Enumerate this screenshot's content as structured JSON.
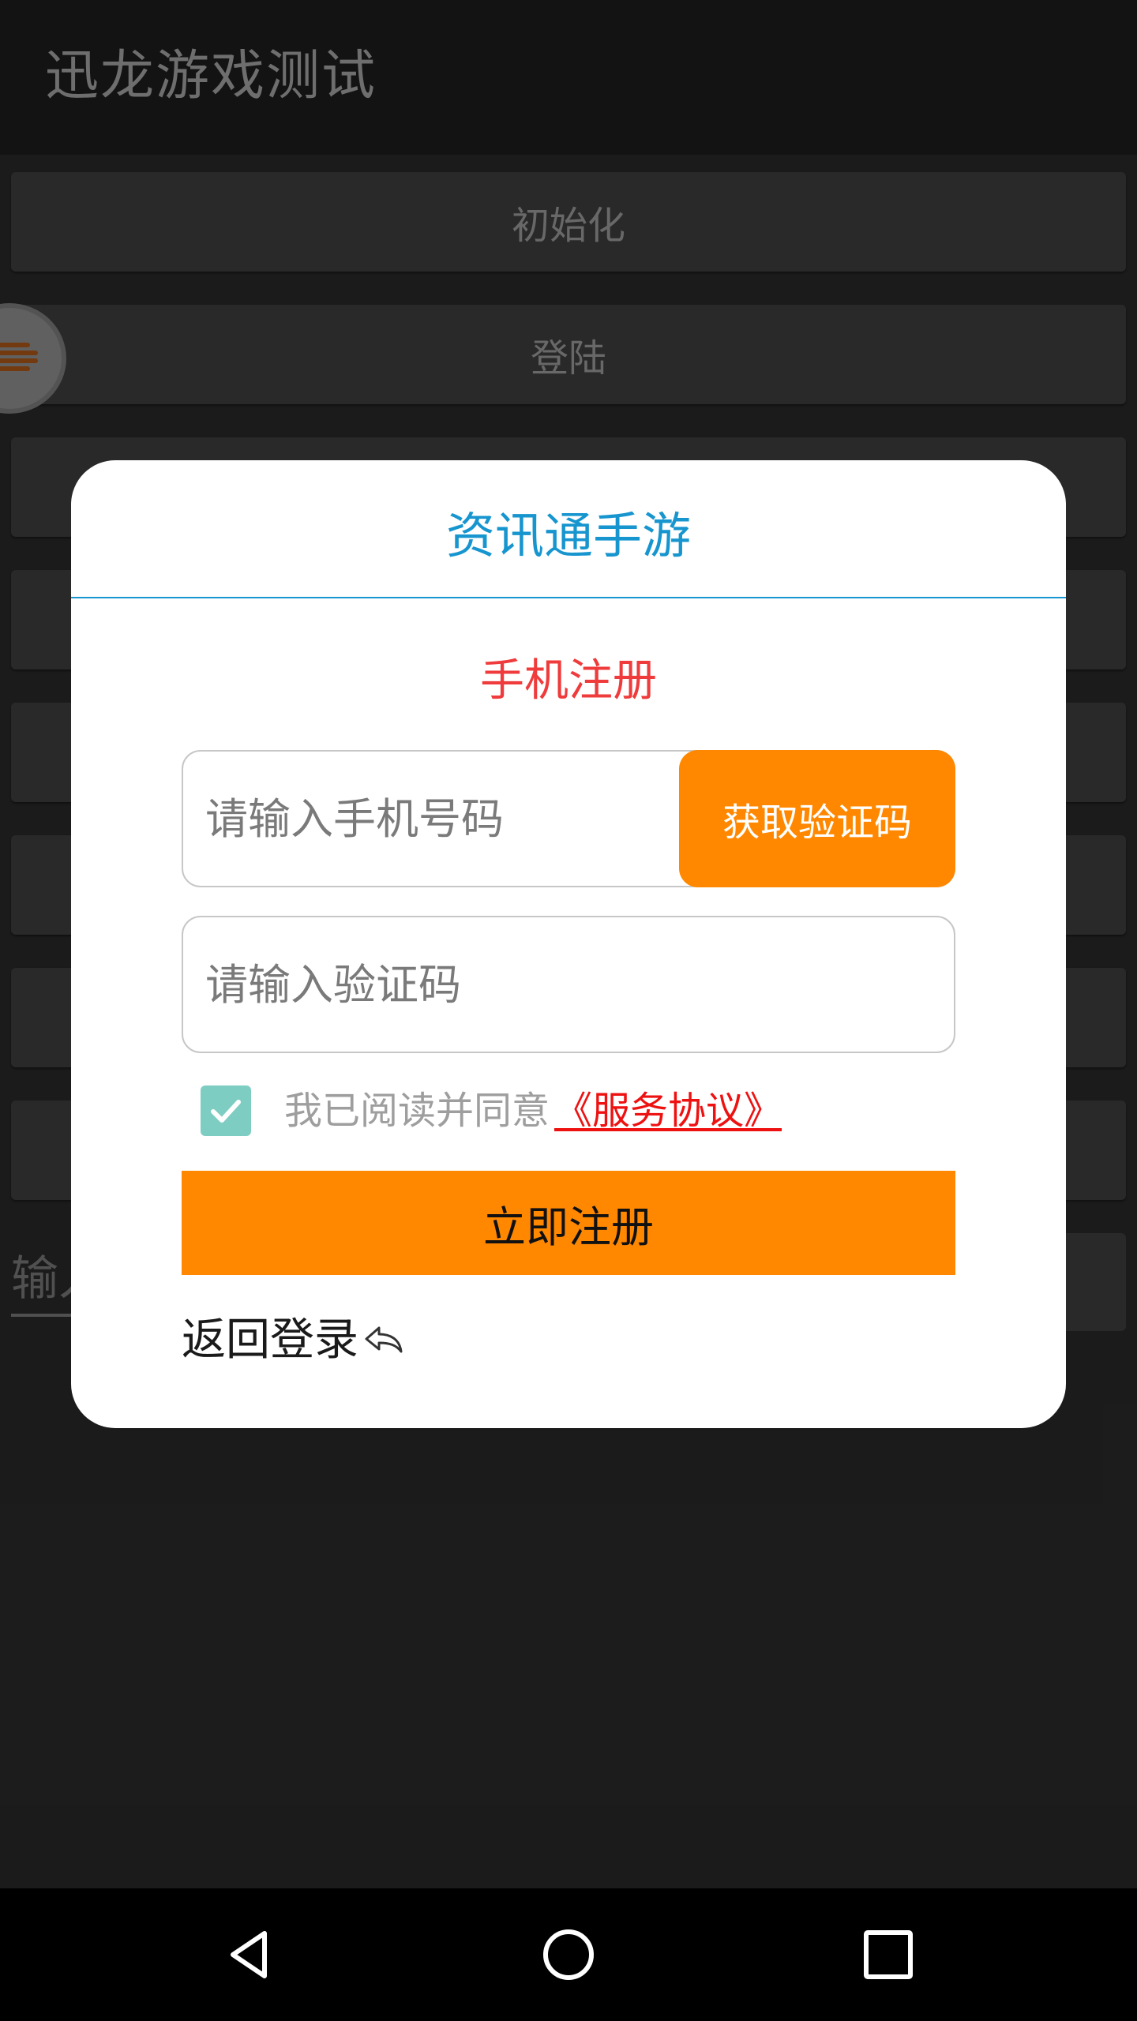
{
  "app": {
    "title": "迅龙游戏测试",
    "buttons": [
      "初始化",
      "登陆",
      "",
      "",
      "",
      "",
      "",
      ""
    ],
    "input_fragment": "输入"
  },
  "dialog": {
    "title": "资讯通手游",
    "subtitle": "手机注册",
    "phone": {
      "placeholder": "请输入手机号码",
      "value": ""
    },
    "get_code_label": "获取验证码",
    "code": {
      "placeholder": "请输入验证码",
      "value": ""
    },
    "agreement": {
      "checked": true,
      "text": "我已阅读并同意",
      "link": "《服务协议》"
    },
    "register_label": "立即注册",
    "back_label": "返回登录"
  },
  "colors": {
    "accent_blue": "#1795cf",
    "subtitle_red": "#ef3b3b",
    "button_orange": "#ff8800",
    "checkbox_teal": "#7ecdc3",
    "link_red": "#ee1111"
  },
  "icons": {
    "floating_ball": "lines-logo-icon",
    "checkbox": "checkmark-icon",
    "back": "reply-arrow-icon",
    "nav": [
      "back-triangle-icon",
      "home-circle-icon",
      "recents-square-icon"
    ]
  }
}
